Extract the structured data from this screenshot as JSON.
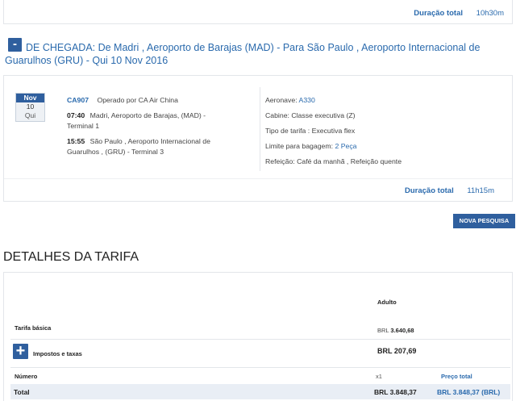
{
  "top_panel": {
    "duration_label": "Duração total",
    "duration_value": "10h30m"
  },
  "segment": {
    "collapse_symbol": "-",
    "title": "DE CHEGADA:  De   Madri , Aeroporto de Barajas (MAD) -   Para   São Paulo , Aeroporto Internacional de Guarulhos (GRU) - Qui 10 Nov 2016",
    "date": {
      "month": "Nov",
      "day": "10",
      "weekday": "Qui"
    },
    "flight_number": "CA907",
    "operated_by": "Operado por  CA   Air China",
    "departure_time": "07:40",
    "departure_place": "Madri, Aeroporto de Barajas, (MAD)   -",
    "departure_terminal": "Terminal 1",
    "arrival_time": "15:55",
    "arrival_place": "São Paulo , Aeroporto Internacional de",
    "arrival_place2": "Guarulhos , (GRU)  -   Terminal 3",
    "aircraft_label": "Aeronave:",
    "aircraft_value": "A330",
    "cabin": "Cabine: Classe executiva (Z)",
    "fare_type": "Tipo de tarifa : Executiva flex",
    "baggage_label": "Limite para bagagem:",
    "baggage_value": "2 Peça",
    "meal": "Refeição: Café da manhã , Refeição quente",
    "duration_label": "Duração total",
    "duration_value": "11h15m"
  },
  "new_search_label": "NOVA PESQUISA",
  "fare_details": {
    "title": "DETALHES DA TARIFA",
    "adult_label": "Adulto",
    "basic_fare_label": "Tarifa básica",
    "basic_fare_currency": "BRL",
    "basic_fare_value": "3.640,68",
    "plus_symbol": "+",
    "taxes_label": "Impostos e taxas",
    "taxes_value": "BRL 207,69",
    "number_label": "Número",
    "number_value": "x1",
    "total_price_label": "Preço total",
    "total_label": "Total",
    "total_value": "BRL 3.848,37",
    "total_brl_value": "BRL 3.848,37 (BRL)"
  }
}
